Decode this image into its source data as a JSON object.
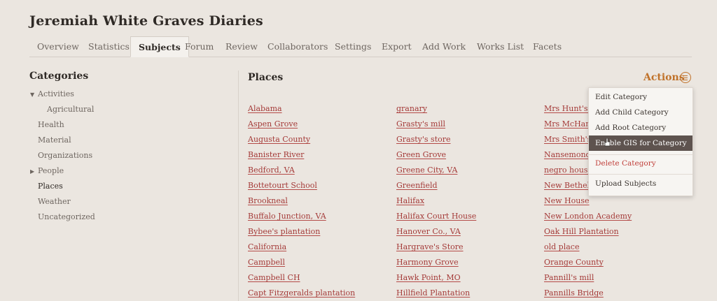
{
  "header": {
    "title": "Jeremiah White Graves Diaries"
  },
  "tabs": [
    "Overview",
    "Statistics",
    "Subjects",
    "Forum",
    "Review",
    "Collaborators",
    "Settings",
    "Export",
    "Add Work",
    "Works List",
    "Facets"
  ],
  "sidebar": {
    "title": "Categories",
    "items": [
      "Activities",
      "Agricultural",
      "Health",
      "Material",
      "Organizations",
      "People",
      "Places",
      "Weather",
      "Uncategorized"
    ]
  },
  "main": {
    "title": "Places",
    "actions_label": "Actions"
  },
  "subjects": {
    "col1": [
      "Alabama",
      "Aspen Grove",
      "Augusta County",
      "Banister River",
      "Bedford, VA",
      "Bottetourt School",
      "Brookneal",
      "Buffalo Junction, VA",
      "Bybee's plantation",
      "California",
      "Campbell",
      "Campbell CH",
      "Capt Fitzgeralds plantation"
    ],
    "col2": [
      "granary",
      "Grasty's mill",
      "Grasty's store",
      "Green Grove",
      "Greene City, VA",
      "Greenfield",
      "Halifax",
      "Halifax Court House",
      "Hanover Co., VA",
      "Hargrave's Store",
      "Harmony Grove",
      "Hawk Point, MO",
      "Hillfield Plantation"
    ],
    "col3": [
      "Mrs Hunt's la",
      "Mrs McHane",
      "Mrs Smith's p",
      "Nansemond",
      "negro house",
      "New Bethel",
      "New House",
      "New London Academy",
      "Oak Hill Plantation",
      "old place",
      "Orange County",
      "Pannill's mill",
      "Pannills Bridge"
    ]
  },
  "menu": [
    "Edit Category",
    "Add Child Category",
    "Add Root Category",
    "Enable GIS for Category",
    "Delete Category",
    "Upload Subjects"
  ],
  "colors": {
    "accent": "#c0722a",
    "link": "#a43a38",
    "highlight": "#5e534f",
    "danger": "#c1413c"
  }
}
